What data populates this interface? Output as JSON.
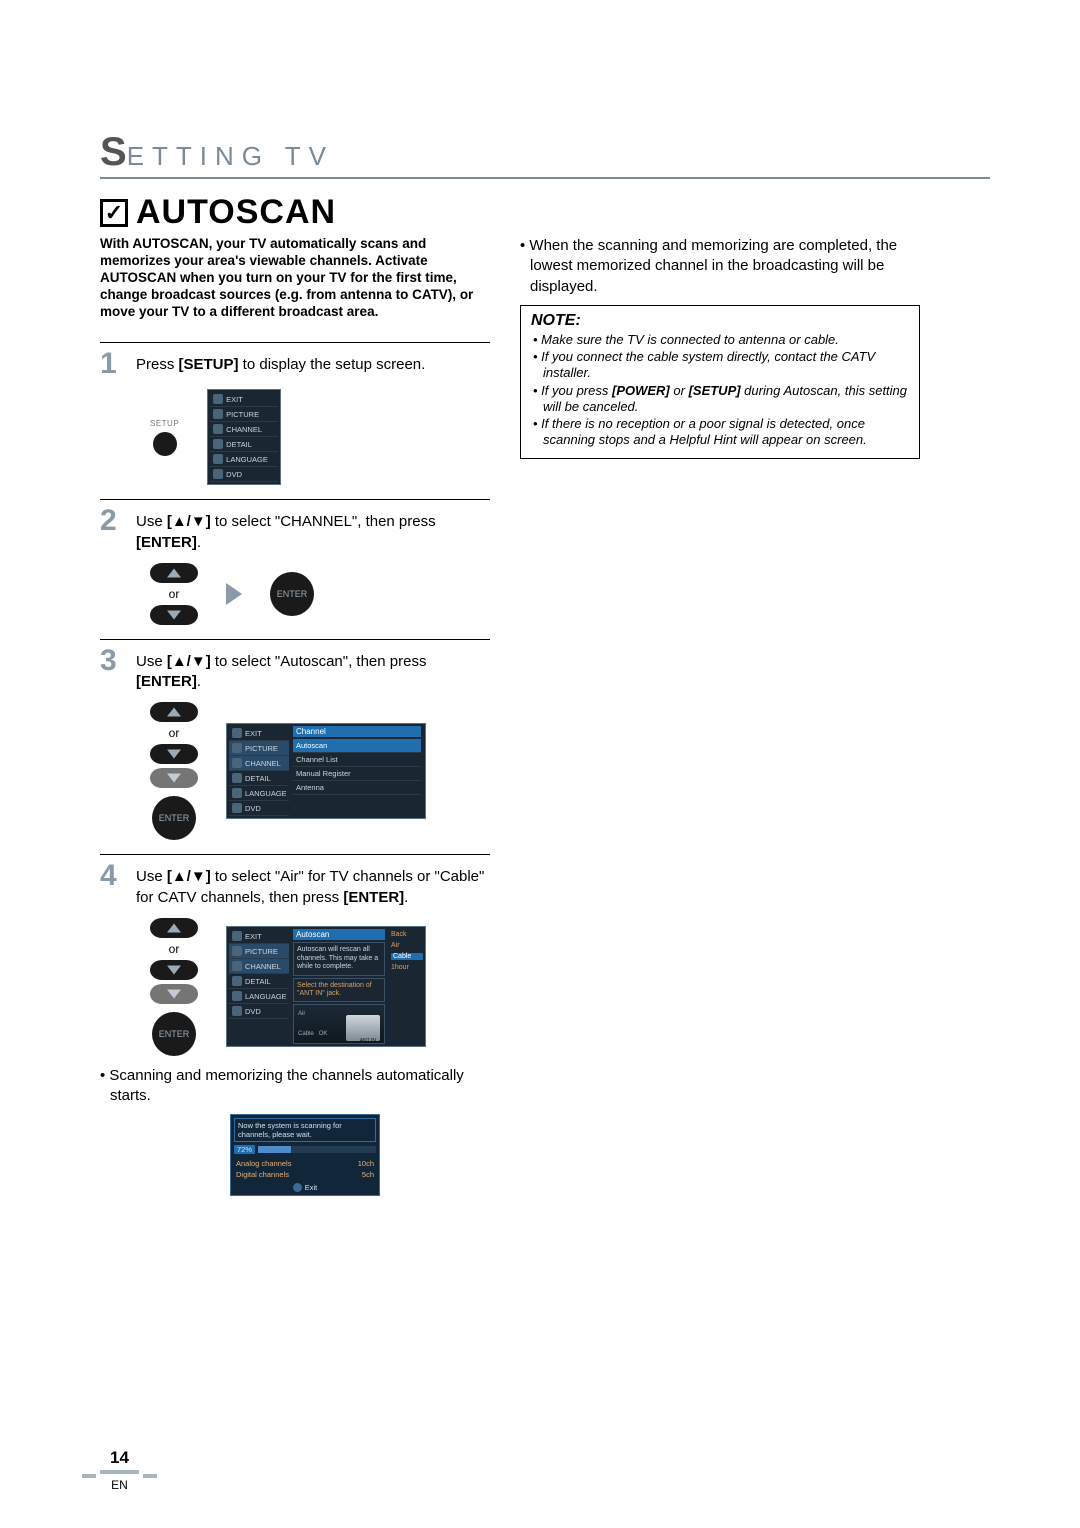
{
  "section": {
    "titleRest": "ETTING  TV",
    "bigS": "S"
  },
  "heading": "AUTOSCAN",
  "intro": "With AUTOSCAN, your TV automatically scans and memorizes your area's viewable channels.  Activate AUTOSCAN when you turn on your TV for the first time, change broadcast sources (e.g. from antenna to CATV), or move your TV to a different broadcast area.",
  "steps": {
    "s1": {
      "num": "1",
      "pre": "Press ",
      "btn": "[SETUP]",
      "post": " to display the setup screen.",
      "setupLabel": "SETUP"
    },
    "s2": {
      "num": "2",
      "pre": "Use ",
      "glyph": "[▲/▼]",
      "mid": " to select \"CHANNEL\", then press ",
      "btn": "[ENTER]",
      "end": ".",
      "or": "or",
      "enter": "ENTER"
    },
    "s3": {
      "num": "3",
      "pre": "Use ",
      "glyph": "[▲/▼]",
      "mid": " to select \"Autoscan\", then press ",
      "btn": "[ENTER]",
      "end": ".",
      "or": "or",
      "enter": "ENTER"
    },
    "s4": {
      "num": "4",
      "pre": "Use ",
      "glyph": "[▲/▼]",
      "mid": " to select \"Air\" for TV channels or \"Cable\" for CATV channels, then press ",
      "btn": "[ENTER]",
      "end": ".",
      "or": "or",
      "enter": "ENTER"
    }
  },
  "osdSidebar": {
    "items": [
      "EXIT",
      "PICTURE",
      "CHANNEL",
      "DETAIL",
      "LANGUAGE",
      "DVD"
    ]
  },
  "osdChannel": {
    "title": "Channel",
    "items": [
      "Autoscan",
      "Channel List",
      "Manual Register",
      "Antenna"
    ]
  },
  "osdAutoscan": {
    "title": "Autoscan",
    "info1": "Autoscan will rescan all channels. This may take a while to complete.",
    "info2": "Select the destination of \"ANT IN\" jack.",
    "air": "Air",
    "cable": "Cable",
    "ok": "OK",
    "right": [
      "Back",
      "Air",
      "Cable",
      "1hour"
    ],
    "antIn": "ANT IN"
  },
  "afterStep4Bullet": "Scanning and memorizing the channels automatically starts.",
  "progress": {
    "msg": "Now the system is scanning for channels, please wait.",
    "pct": "72%",
    "analogLabel": "Analog channels",
    "analogVal": "10ch",
    "digitalLabel": "Digital channels",
    "digitalVal": "5ch",
    "exit": "Exit"
  },
  "rightCol": {
    "completion": "When the scanning and memorizing are completed, the lowest memorized channel in the broadcasting will be displayed.",
    "noteTitle": "NOTE:",
    "notes": [
      "Make sure the TV is connected to antenna or cable.",
      "If you connect the cable system directly, contact the CATV installer.",
      "If you press [POWER] or [SETUP] during Autoscan, this setting will be canceled.",
      "If there is no reception or a poor signal is detected, once scanning stops and a Helpful Hint will appear on screen."
    ]
  },
  "footer": {
    "page": "14",
    "lang": "EN"
  }
}
